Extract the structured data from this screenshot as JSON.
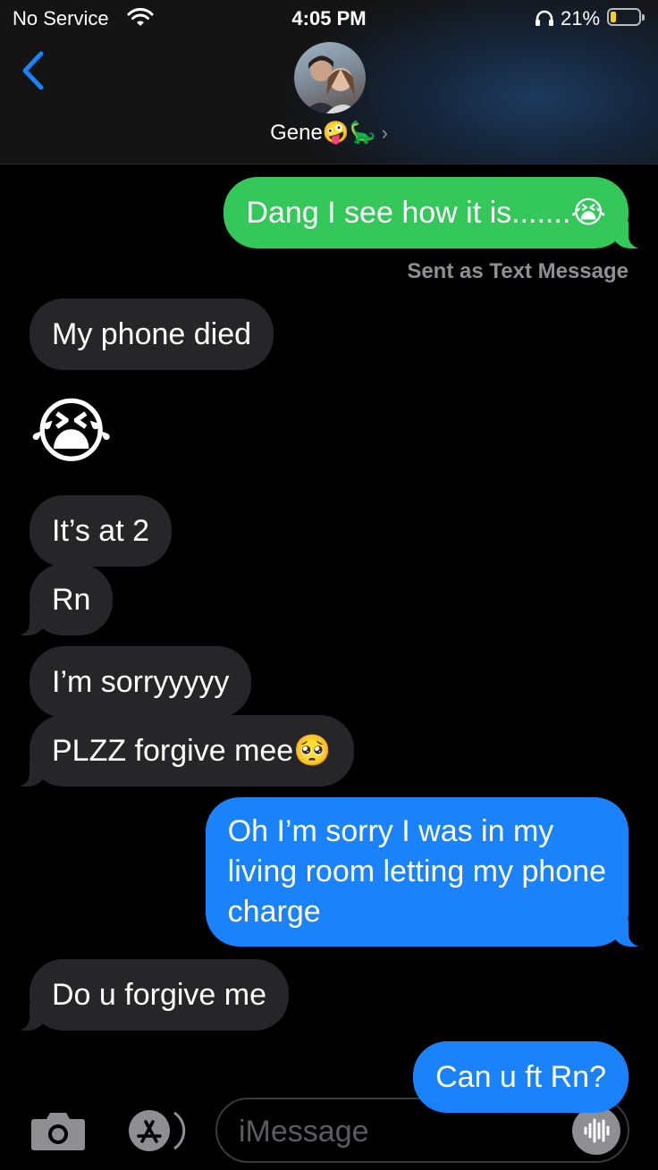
{
  "status_bar": {
    "carrier": "No Service",
    "time": "4:05 PM",
    "battery_percent": "21%",
    "battery_level": 0.21
  },
  "header": {
    "contact_name": "Gene",
    "contact_emoji": "🤪🦕",
    "chevron": "›"
  },
  "messages": [
    {
      "text": "Dang I see how it is.......😭",
      "direction": "outgoing",
      "color": "#34c759"
    },
    {
      "note": "Sent as Text Message"
    },
    {
      "text": "My phone died",
      "direction": "incoming"
    },
    {
      "text": "😭",
      "direction": "incoming",
      "big_emoji": true
    },
    {
      "text": "It’s at 2",
      "direction": "incoming"
    },
    {
      "text": "Rn",
      "direction": "incoming"
    },
    {
      "text": "I’m sorryyyyy",
      "direction": "incoming"
    },
    {
      "text": "PLZZ forgive mee🥺",
      "direction": "incoming"
    },
    {
      "lines": [
        "Oh I’m sorry I was in my",
        "living room letting my phone",
        "charge"
      ],
      "direction": "outgoing",
      "color": "#1a82fb"
    },
    {
      "text": "Do u forgive me",
      "direction": "incoming"
    },
    {
      "text": "Can u ft Rn?",
      "direction": "outgoing",
      "color": "#1a82fb"
    }
  ],
  "input_bar": {
    "placeholder": "iMessage"
  },
  "icons": [
    "wifi-icon",
    "headphones-icon",
    "battery-icon",
    "back-chevron-icon",
    "camera-icon",
    "app-store-icon",
    "audio-waveform-icon"
  ]
}
